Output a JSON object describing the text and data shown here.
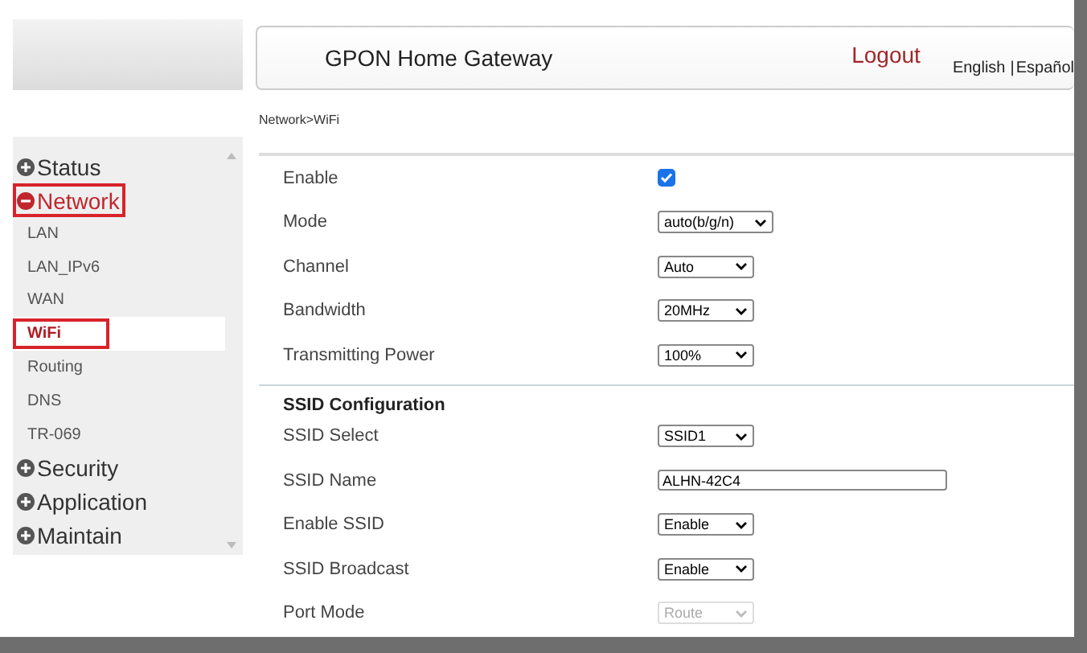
{
  "header": {
    "title": "GPON Home Gateway",
    "logout": "Logout",
    "languages": [
      "English",
      "Español"
    ],
    "separator": "|"
  },
  "sidebar": {
    "items": [
      {
        "label": "Status",
        "expanded": false,
        "highlighted": false
      },
      {
        "label": "Network",
        "expanded": true,
        "highlighted": true,
        "children": [
          {
            "label": "LAN",
            "selected": false,
            "highlighted": false
          },
          {
            "label": "LAN_IPv6",
            "selected": false,
            "highlighted": false
          },
          {
            "label": "WAN",
            "selected": false,
            "highlighted": false
          },
          {
            "label": "WiFi",
            "selected": true,
            "highlighted": true
          },
          {
            "label": "Routing",
            "selected": false,
            "highlighted": false
          },
          {
            "label": "DNS",
            "selected": false,
            "highlighted": false
          },
          {
            "label": "TR-069",
            "selected": false,
            "highlighted": false
          }
        ]
      },
      {
        "label": "Security",
        "expanded": false,
        "highlighted": false
      },
      {
        "label": "Application",
        "expanded": false,
        "highlighted": false
      },
      {
        "label": "Maintain",
        "expanded": false,
        "highlighted": false
      }
    ]
  },
  "breadcrumb": "Network>WiFi",
  "sections": [
    {
      "fields": [
        {
          "kind": "checkbox",
          "label": "Enable",
          "checked": true
        },
        {
          "kind": "select",
          "label": "Mode",
          "value": "auto(b/g/n)",
          "disabled": false
        },
        {
          "kind": "select",
          "label": "Channel",
          "value": "Auto",
          "disabled": false
        },
        {
          "kind": "select",
          "label": "Bandwidth",
          "value": "20MHz",
          "disabled": false
        },
        {
          "kind": "select",
          "label": "Transmitting Power",
          "value": "100%",
          "disabled": false
        }
      ]
    },
    {
      "title": "SSID Configuration",
      "fields": [
        {
          "kind": "select",
          "label": "SSID Select",
          "value": "SSID1",
          "disabled": false
        },
        {
          "kind": "text",
          "label": "SSID Name",
          "value": "ALHN-42C4"
        },
        {
          "kind": "select",
          "label": "Enable SSID",
          "value": "Enable",
          "disabled": false
        },
        {
          "kind": "select",
          "label": "SSID Broadcast",
          "value": "Enable",
          "disabled": false
        },
        {
          "kind": "select",
          "label": "Port Mode",
          "value": "Route",
          "disabled": true
        }
      ]
    }
  ]
}
